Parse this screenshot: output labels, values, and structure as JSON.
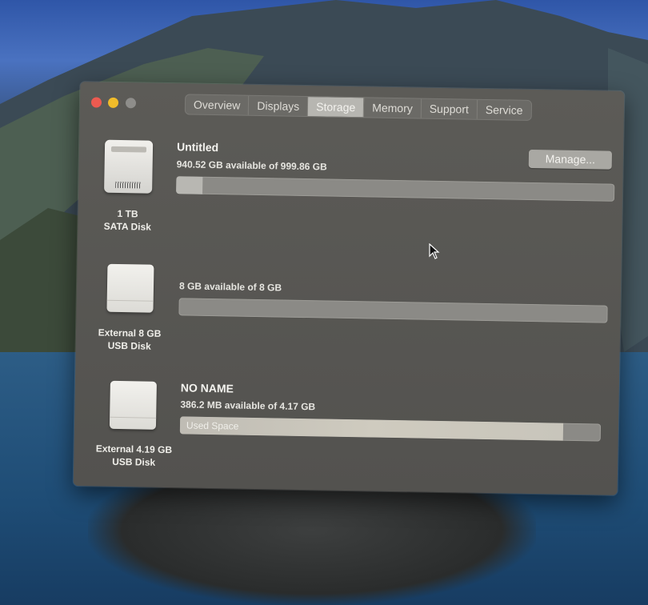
{
  "window": {
    "tabs": [
      "Overview",
      "Displays",
      "Storage",
      "Memory",
      "Support",
      "Service"
    ],
    "selected_tab": "Storage"
  },
  "disks": [
    {
      "icon": "internal-drive-icon",
      "caption_line1": "1 TB",
      "caption_line2": "SATA Disk",
      "volume_name": "Untitled",
      "availability": "940.52 GB available of 999.86 GB",
      "used_fraction": 0.06,
      "button_label": "Manage..."
    },
    {
      "icon": "usb-drive-icon",
      "caption_line1": "External 8 GB",
      "caption_line2": "USB Disk",
      "volume_name": "",
      "availability": "8 GB available of 8 GB",
      "used_fraction": 0.0
    },
    {
      "icon": "usb-drive-icon",
      "caption_line1": "External 4.19 GB",
      "caption_line2": "USB Disk",
      "volume_name": "NO NAME",
      "availability": "386.2 MB available of 4.17 GB",
      "used_fraction": 0.91,
      "used_label": "Used Space"
    }
  ]
}
